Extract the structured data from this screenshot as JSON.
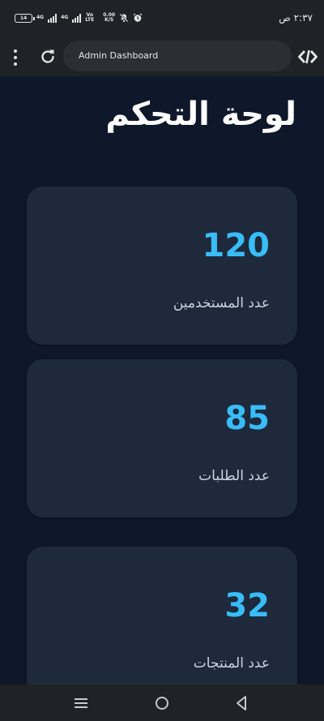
{
  "status_bar": {
    "battery": "14",
    "network_1": "4G",
    "network_2": "4G",
    "volte_top": "Vo",
    "volte_bottom": "LTE",
    "speed_top": "0.00",
    "speed_bottom": "K/S",
    "time": "٢:٣٧ ص"
  },
  "browser": {
    "url_text": "Admin Dashboard",
    "icons": [
      "more-vert-icon",
      "reload-icon",
      "devtools-icon"
    ]
  },
  "dashboard": {
    "title": "لوحة التحكم",
    "cards": [
      {
        "value": "120",
        "label": "عدد المستخدمين"
      },
      {
        "value": "85",
        "label": "عدد الطلبات"
      },
      {
        "value": "32",
        "label": "عدد المنتجات"
      }
    ],
    "colors": {
      "background": "#0f172a",
      "card": "#1e293b",
      "accent": "#38bdf8",
      "label": "#cbd5e1"
    }
  },
  "nav": {
    "icons": [
      "recents-icon",
      "home-icon",
      "back-icon"
    ]
  }
}
